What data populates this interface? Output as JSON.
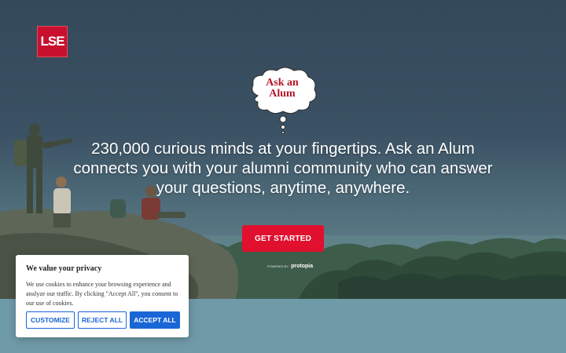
{
  "brand": {
    "logo_text": "LSE",
    "accent": "#c8102e"
  },
  "hero": {
    "bubble_line1": "Ask an",
    "bubble_line2": "Alum",
    "headline": "230,000 curious minds at your fingertips. Ask an Alum connects you with your alumni community who can answer your questions, anytime, anywhere.",
    "cta_label": "GET STARTED",
    "powered_prefix": "POWERED BY",
    "powered_brand": "protopia"
  },
  "cookie": {
    "title": "We value your privacy",
    "body": "We use cookies to enhance your browsing experience and analyze our traffic. By clicking \"Accept All\", you consent to our use of cookies.",
    "customize_label": "CUSTOMIZE",
    "reject_label": "REJECT ALL",
    "accept_label": "ACCEPT ALL",
    "button_color": "#1a66d6"
  },
  "colors": {
    "cta": "#e0102e",
    "lower_band": "#6f9aa8"
  }
}
